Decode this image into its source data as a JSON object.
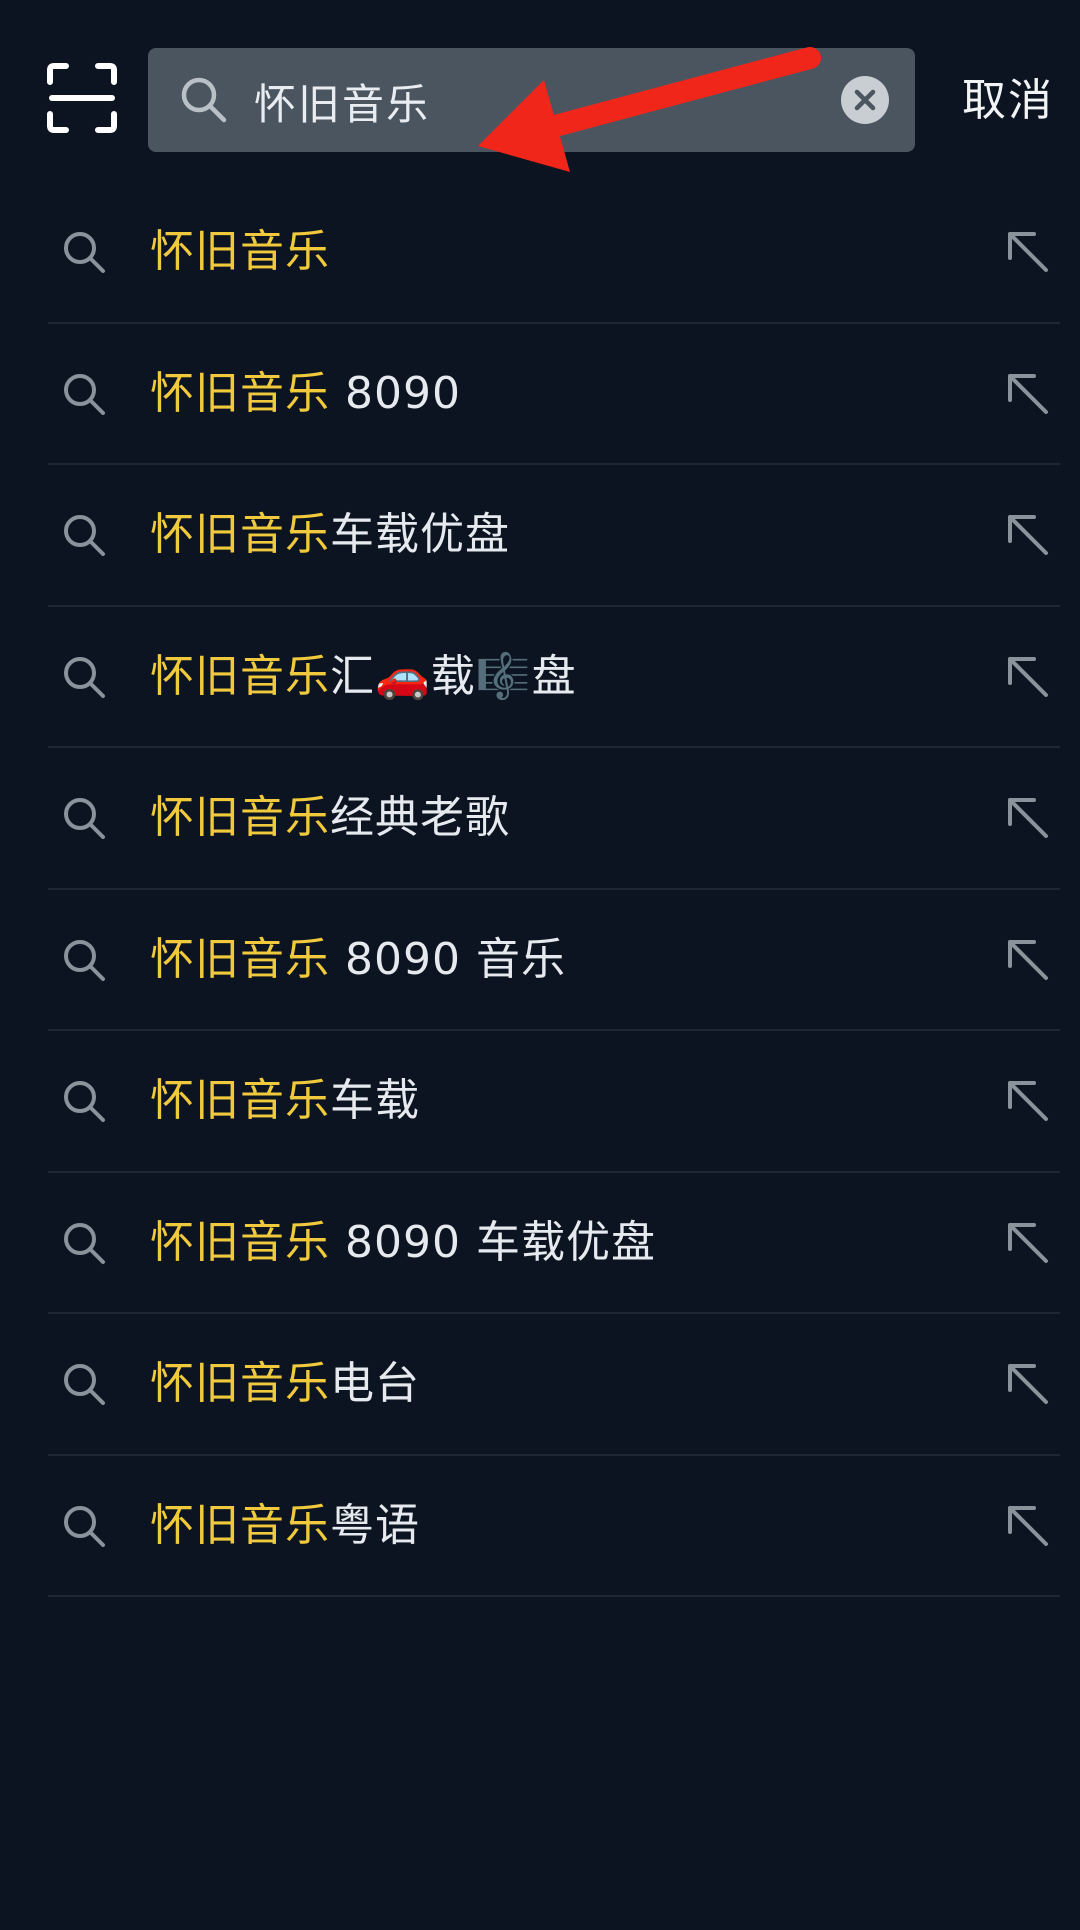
{
  "search": {
    "value": "怀旧音乐",
    "placeholder": ""
  },
  "header": {
    "cancel_label": "取消"
  },
  "suggestions": [
    {
      "highlight": "怀旧音乐",
      "rest": ""
    },
    {
      "highlight": "怀旧音乐",
      "rest": " 8090"
    },
    {
      "highlight": "怀旧音乐",
      "rest": "车载优盘"
    },
    {
      "highlight": "怀旧音乐",
      "rest": "汇🚗载🎼盘"
    },
    {
      "highlight": "怀旧音乐",
      "rest": "经典老歌"
    },
    {
      "highlight": "怀旧音乐",
      "rest": " 8090 音乐"
    },
    {
      "highlight": "怀旧音乐",
      "rest": "车载"
    },
    {
      "highlight": "怀旧音乐",
      "rest": " 8090 车载优盘"
    },
    {
      "highlight": "怀旧音乐",
      "rest": "电台"
    },
    {
      "highlight": "怀旧音乐",
      "rest": "粤语"
    }
  ],
  "colors": {
    "background": "#0b1420",
    "search_box": "#4a5560",
    "highlight": "#f0c93c",
    "text": "#e6eaee",
    "icon": "#8a939c",
    "annotation": "#f0261a"
  },
  "icons": {
    "scan": "scan-icon",
    "search": "search-icon",
    "clear": "clear-icon",
    "fill": "arrow-up-left-icon"
  }
}
